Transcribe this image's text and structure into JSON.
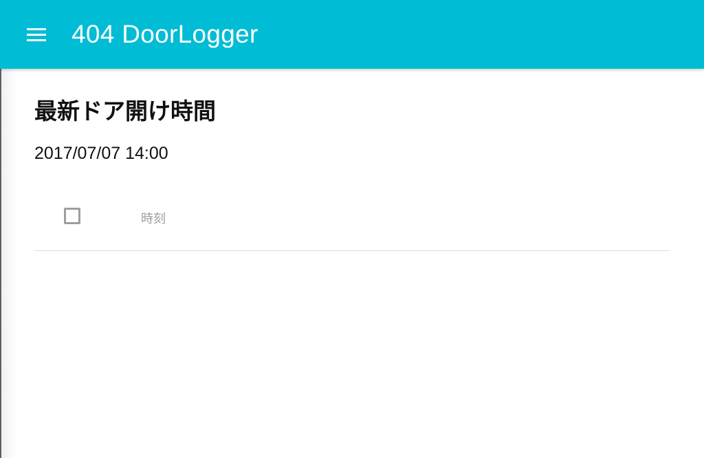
{
  "app_bar": {
    "title": "404 DoorLogger",
    "menu_icon": "hamburger-menu-icon",
    "color": "#00bcd4"
  },
  "main": {
    "heading": "最新ドア開け時間",
    "latest_time": "2017/07/07 14:00",
    "table": {
      "columns": [
        "時刻"
      ],
      "select_all_checked": false,
      "rows": []
    }
  }
}
